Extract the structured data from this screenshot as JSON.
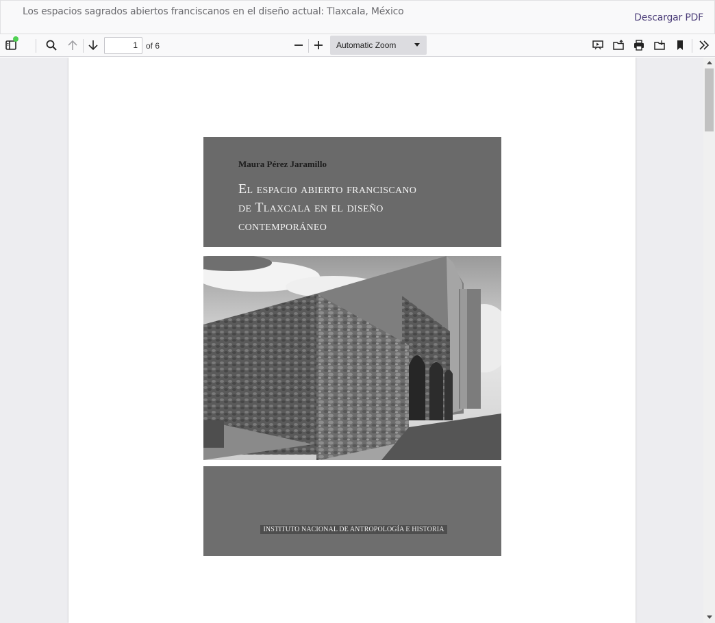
{
  "header": {
    "title": "Los espacios sagrados abiertos franciscanos en el diseño actual: Tlaxcala, México",
    "download_label": "Descargar PDF"
  },
  "toolbar": {
    "page_number": "1",
    "page_of": "of 6",
    "zoom_label": "Automatic Zoom",
    "icons": [
      "sidebar-toggle-icon",
      "search-icon",
      "arrow-up-icon",
      "arrow-down-icon",
      "zoom-out-icon",
      "zoom-in-icon",
      "presentation-icon",
      "open-file-icon",
      "print-icon",
      "download-icon",
      "bookmark-icon",
      "more-tools-icon"
    ]
  },
  "cover": {
    "author": "Maura Pérez Jaramillo",
    "title_line1": "El espacio abierto franciscano",
    "title_line2": "de Tlaxcala en el diseño",
    "title_line3": "contemporáneo",
    "publisher": "INSTITUTO NACIONAL DE ANTROPOLOGÍA E HISTORIA"
  },
  "colors": {
    "accent_link": "#4d3f7a",
    "notification_dot": "#4fd153",
    "cover_band": "#6a6a6a"
  }
}
